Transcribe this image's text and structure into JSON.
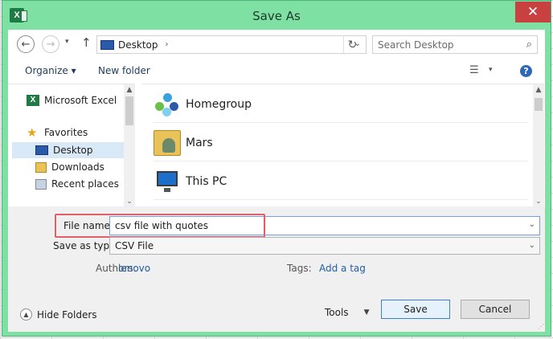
{
  "window": {
    "title": "Save As",
    "app_icon": "X",
    "close_icon": "✕"
  },
  "address": {
    "location": "Desktop",
    "search_placeholder": "Search Desktop"
  },
  "toolbar": {
    "organize": "Organize ▾",
    "new_folder": "New folder",
    "help": "?"
  },
  "nav": {
    "items": [
      {
        "label": "Microsoft Excel",
        "icon": "excel-icon"
      },
      {
        "label": "Favorites",
        "icon": "star-icon"
      },
      {
        "label": "Desktop",
        "icon": "desktop-icon",
        "selected": true
      },
      {
        "label": "Downloads",
        "icon": "downloads-icon"
      },
      {
        "label": "Recent places",
        "icon": "recent-places-icon"
      }
    ]
  },
  "files": [
    {
      "name": "Homegroup",
      "icon": "homegroup-icon"
    },
    {
      "name": "Mars",
      "icon": "user-folder-icon"
    },
    {
      "name": "This PC",
      "icon": "computer-icon"
    }
  ],
  "form": {
    "file_name_label": "File name:",
    "file_name_value": "csv file with quotes",
    "save_type_label": "Save as type:",
    "save_type_value": "CSV File",
    "authors_label": "Authors:",
    "authors_value": "lenovo",
    "tags_label": "Tags:",
    "tags_value": "Add a tag"
  },
  "footer": {
    "hide_folders": "Hide Folders",
    "tools": "Tools",
    "save": "Save",
    "cancel": "Cancel"
  },
  "colors": {
    "frame": "#7ee0a3",
    "close": "#c84040",
    "highlight": "#e0606a",
    "link": "#1f5ea8"
  }
}
